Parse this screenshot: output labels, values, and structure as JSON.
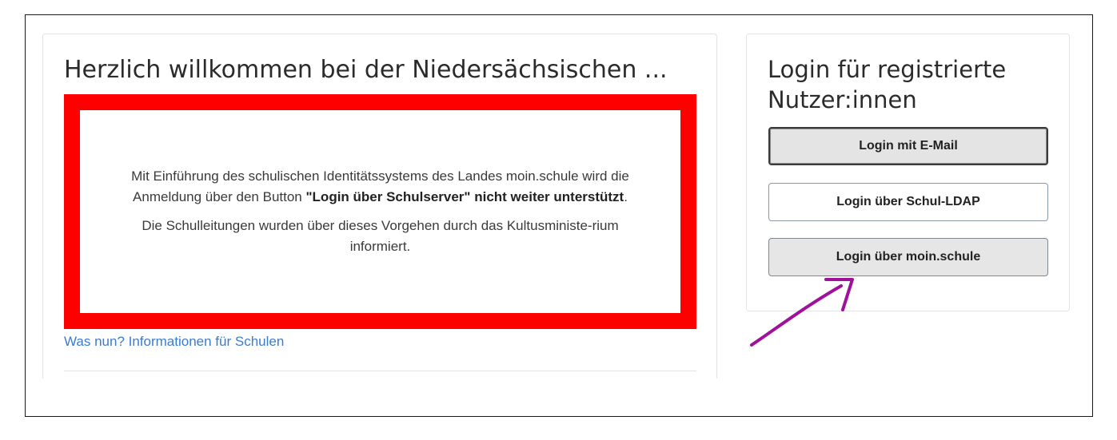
{
  "welcome": {
    "title": "Herzlich willkommen bei der Niedersächsischen ...",
    "notice_p1_part1": "Mit Einführung des schulischen Identitätssystems des Landes moin.schule wird die Anmeldung über den Button ",
    "notice_p1_bold": "\"Login über Schulserver\" nicht weiter unterstützt",
    "notice_p1_end": ".",
    "notice_p2": "Die Schulleitungen wurden über dieses Vorgehen durch das Kultusministe-rium informiert.",
    "info_link": "Was nun? Informationen für Schulen"
  },
  "login": {
    "title": "Login für registrierte Nutzer:innen",
    "buttons": [
      {
        "label": "Login mit E-Mail"
      },
      {
        "label": "Login über Schul-LDAP"
      },
      {
        "label": "Login über moin.schule"
      }
    ]
  },
  "colors": {
    "notice_border": "#ff0000",
    "link": "#3b7ccf",
    "annotation_arrow": "#a0109a"
  },
  "annotation": {
    "icon": "hand-drawn-arrow-icon",
    "target": "Login über moin.schule"
  }
}
